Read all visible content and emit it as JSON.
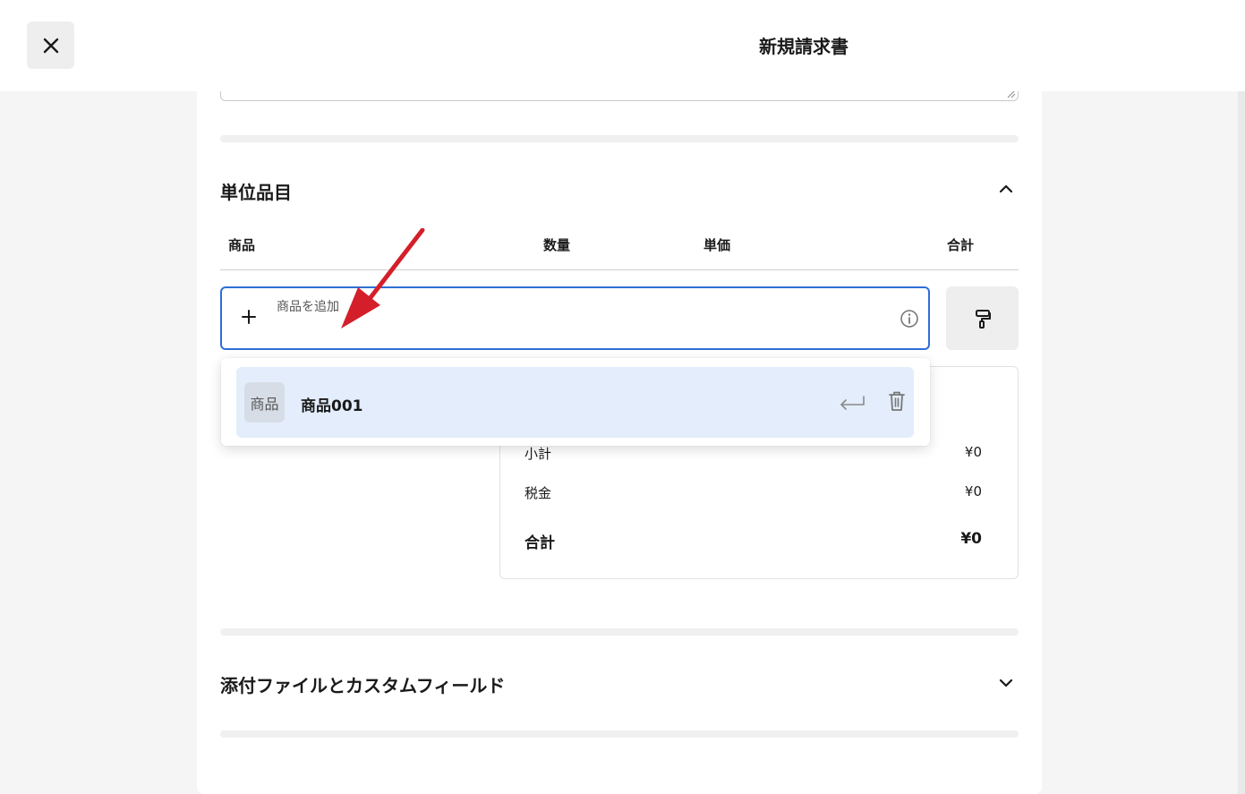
{
  "header": {
    "title": "新規請求書",
    "close_icon": "close-icon"
  },
  "line_items": {
    "section_title": "単位品目",
    "columns": [
      "商品",
      "数量",
      "単価",
      "合計"
    ],
    "add_input": {
      "placeholder": "商品を追加"
    },
    "dropdown": {
      "items": [
        {
          "badge": "商品",
          "name": "商品001"
        }
      ]
    },
    "totals": {
      "subtotal_label": "小計",
      "subtotal_value": "¥0",
      "tax_label": "税金",
      "tax_value": "¥0",
      "total_label": "合計",
      "total_value": "¥0"
    }
  },
  "attachments": {
    "section_title": "添付ファイルとカスタムフィールド"
  },
  "colors": {
    "accent": "#2d6fd6",
    "annotation_arrow": "#d41f2a",
    "highlight": "#e3edfb"
  }
}
